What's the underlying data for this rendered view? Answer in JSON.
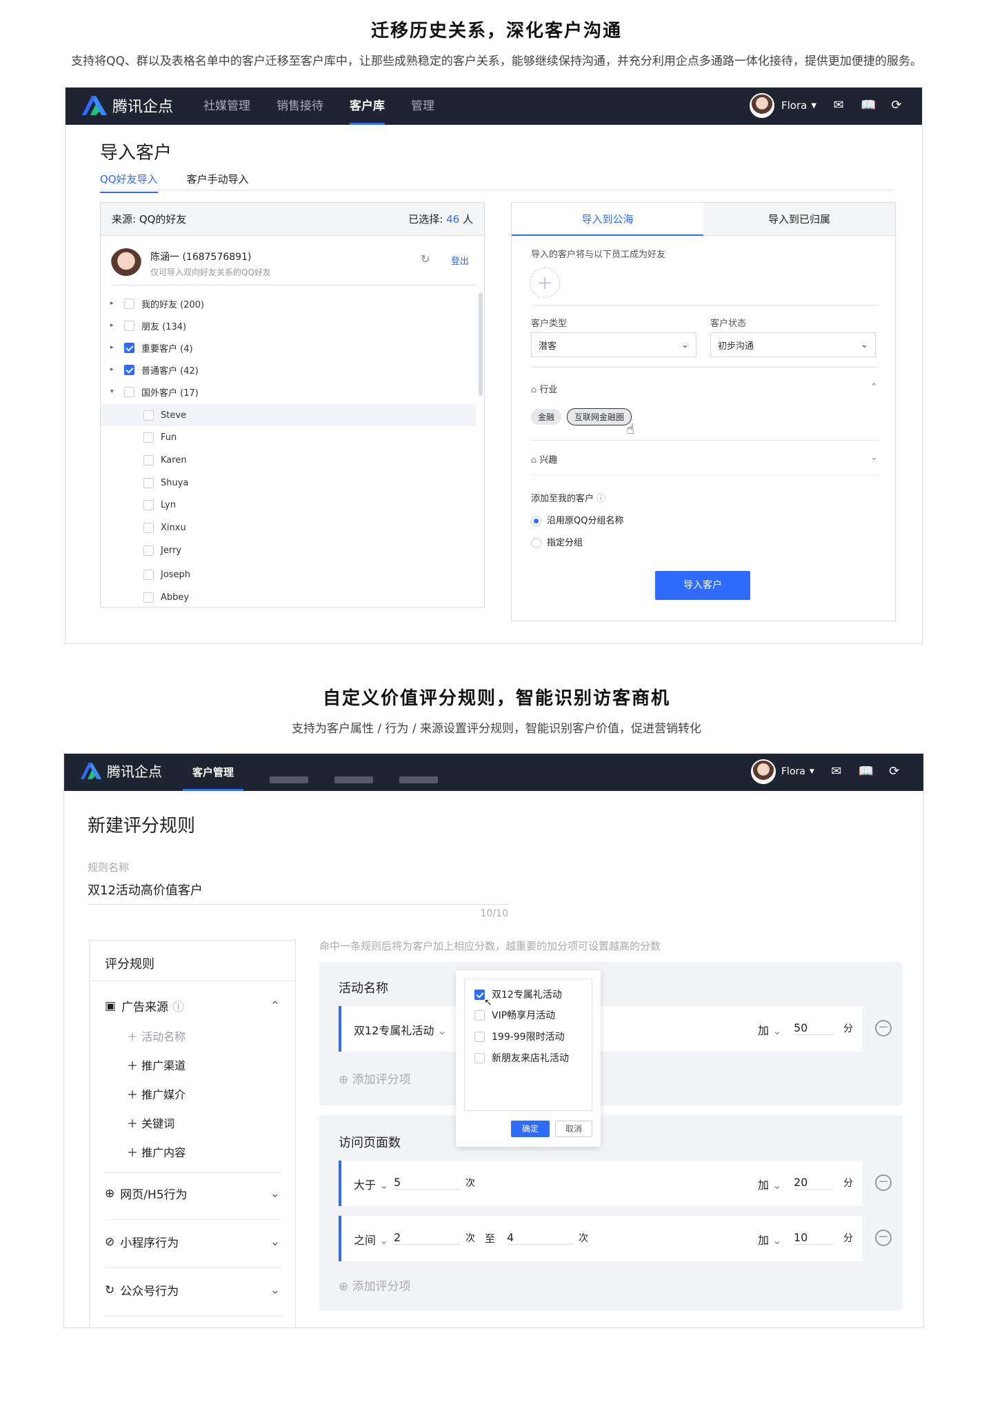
{
  "section1": {
    "title": "迁移历史关系，深化客户沟通",
    "subtitle": "支持将QQ、群以及表格名单中的客户迁移至客户库中，让那些成熟稳定的客户关系，能够继续保持沟通，并充分利用企点多通路一体化接待，提供更加便捷的服务。"
  },
  "app": {
    "logo_text": "腾讯企点",
    "nav1": [
      "社媒管理",
      "销售接待",
      "客户库",
      "管理"
    ],
    "user_name": "Flora",
    "icons": [
      "mail-icon",
      "book-icon",
      "logout-icon"
    ]
  },
  "import": {
    "page_title": "导入客户",
    "tab_qq": "QQ好友导入",
    "tab_manual": "客户手动导入",
    "source_label": "来源: QQ的好友",
    "selected_label": "已选择:",
    "selected_count": "46",
    "selected_unit": "人",
    "account_name": "陈涵一 (1687576891)",
    "account_hint": "仅可导入双向好友关系的QQ好友",
    "logout": "登出",
    "groups": [
      {
        "label": "我的好友 (200)",
        "checked": false,
        "arrow": "▸"
      },
      {
        "label": "朋友 (134)",
        "checked": false,
        "arrow": "▸"
      },
      {
        "label": "重要客户 (4)",
        "checked": true,
        "arrow": "▸"
      },
      {
        "label": "普通客户 (42)",
        "checked": true,
        "arrow": "▸"
      },
      {
        "label": "国外客户 (17)",
        "checked": false,
        "arrow": "▾"
      }
    ],
    "friends": [
      "Steve",
      "Fun",
      "Karen",
      "Shuya",
      "Lyn",
      "Xinxu",
      "Jerry",
      "Joseph",
      "Abbey"
    ],
    "right_tab_sea": "导入到公海",
    "right_tab_owned": "导入到已归属",
    "staff_label": "导入的客户将与以下员工成为好友",
    "type_label": "客户类型",
    "type_value": "潜客",
    "status_label": "客户状态",
    "status_value": "初步沟通",
    "industry_label": "行业",
    "industry_tags": [
      "金融",
      "互联网金融圈"
    ],
    "interest_label": "兴趣",
    "add_to_label": "添加至我的客户",
    "radio_keep": "沿用原QQ分组名称",
    "radio_group": "指定分组",
    "import_button": "导入客户"
  },
  "section2": {
    "title": "自定义价值评分规则，智能识别访客商机",
    "subtitle": "支持为客户属性 / 行为 / 来源设置评分规则，智能识别客户价值，促进营销转化"
  },
  "scoring": {
    "nav2": [
      "客户管理"
    ],
    "page_title": "新建评分规则",
    "name_label": "规则名称",
    "name_value": "双12活动高价值客户",
    "name_count": "10/10",
    "hint": "命中一条规则后将为客户加上相应分数，越重要的加分项可设置越高的分数",
    "sidebar_title": "评分规则",
    "ad_source": "广告来源",
    "ad_items": [
      "活动名称",
      "推广渠道",
      "推广媒介",
      "关键词",
      "推广内容"
    ],
    "behaviors": [
      "网页/H5行为",
      "小程序行为",
      "公众号行为"
    ],
    "activity_title": "活动名称",
    "activity_select": "双12专属礼活动",
    "plus_label": "加",
    "plus_value_1": "50",
    "score_unit": "分",
    "add_item": "添加评分项",
    "dropdown_options": [
      {
        "label": "双12专属礼活动",
        "checked": true
      },
      {
        "label": "VIP畅享月活动",
        "checked": false
      },
      {
        "label": "199-99限时活动",
        "checked": false
      },
      {
        "label": "新朋友来店礼活动",
        "checked": false
      }
    ],
    "confirm": "确定",
    "cancel": "取消",
    "pages_title": "访问页面数",
    "op_gt": "大于",
    "gt_value": "5",
    "times_unit": "次",
    "plus_value_2": "20",
    "op_between": "之间",
    "between_from": "2",
    "to_label": "至",
    "between_to": "4",
    "plus_value_3": "10"
  }
}
